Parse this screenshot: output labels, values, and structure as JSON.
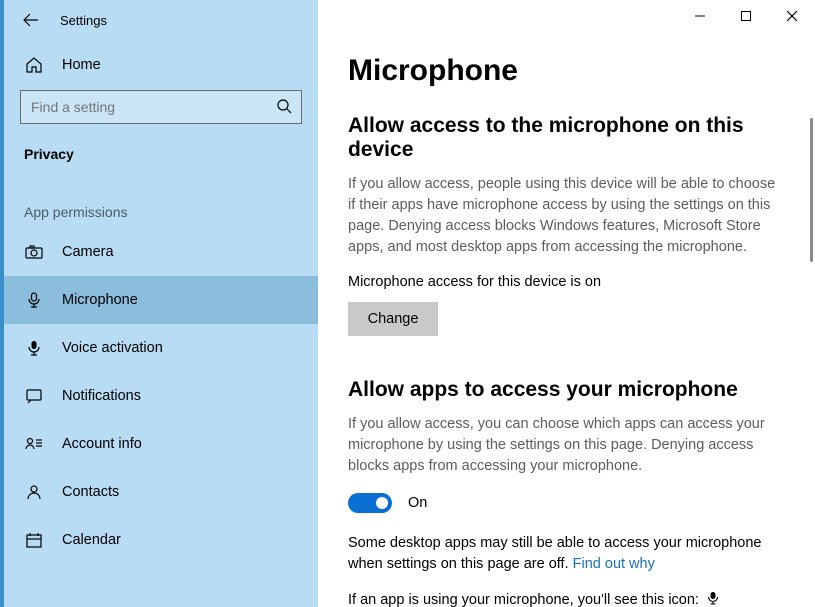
{
  "window": {
    "app_title": "Settings"
  },
  "sidebar": {
    "home_label": "Home",
    "search_placeholder": "Find a setting",
    "section_title": "Privacy",
    "group_label": "App permissions",
    "items": [
      {
        "icon": "camera-icon",
        "label": "Camera"
      },
      {
        "icon": "microphone-icon",
        "label": "Microphone",
        "active": true
      },
      {
        "icon": "voice-activation-icon",
        "label": "Voice activation"
      },
      {
        "icon": "notifications-icon",
        "label": "Notifications"
      },
      {
        "icon": "account-info-icon",
        "label": "Account info"
      },
      {
        "icon": "contacts-icon",
        "label": "Contacts"
      },
      {
        "icon": "calendar-icon",
        "label": "Calendar"
      }
    ]
  },
  "main": {
    "title": "Microphone",
    "section1": {
      "heading": "Allow access to the microphone on this device",
      "body": "If you allow access, people using this device will be able to choose if their apps have microphone access by using the settings on this page. Denying access blocks Windows features, Microsoft Store apps, and most desktop apps from accessing the microphone.",
      "status": "Microphone access for this device is on",
      "button": "Change"
    },
    "section2": {
      "heading": "Allow apps to access your microphone",
      "body": "If you allow access, you can choose which apps can access your microphone by using the settings on this page. Denying access blocks apps from accessing your microphone.",
      "toggle_state": "On",
      "note_prefix": "Some desktop apps may still be able to access your microphone when settings on this page are off. ",
      "note_link": "Find out why",
      "usage_text": "If an app is using your microphone, you'll see this icon:"
    }
  }
}
